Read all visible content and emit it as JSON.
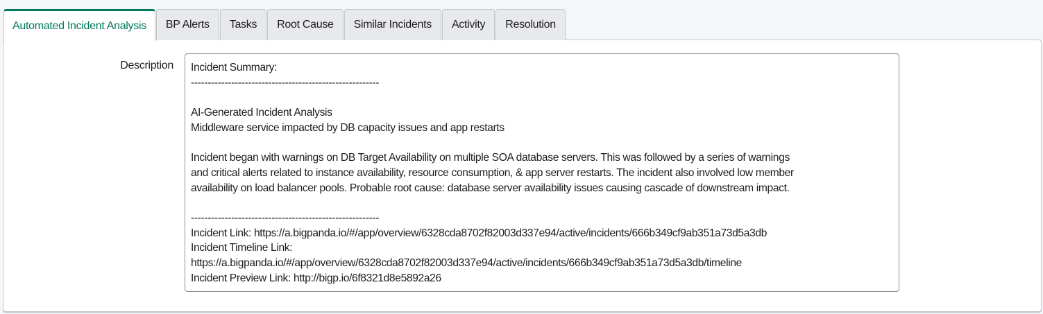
{
  "tabs": [
    {
      "label": "Automated Incident Analysis",
      "active": true
    },
    {
      "label": "BP Alerts"
    },
    {
      "label": "Tasks"
    },
    {
      "label": "Root Cause"
    },
    {
      "label": "Similar Incidents"
    },
    {
      "label": "Activity"
    },
    {
      "label": "Resolution"
    }
  ],
  "colors": {
    "accent": "#00795a",
    "tab_bg": "#e8e9ec"
  },
  "form": {
    "description_label": "Description",
    "description_value": "Incident Summary:\n--------------------------------------------------------\n\nAI-Generated Incident Analysis\nMiddleware service impacted by DB capacity issues and app restarts\n\nIncident began with warnings on DB Target Availability on multiple SOA database servers. This was followed by a series of warnings\nand critical alerts related to instance availability, resource consumption, & app server restarts. The incident also involved low member\navailability on load balancer pools. Probable root cause: database server availability issues causing cascade of downstream impact.\n\n--------------------------------------------------------\nIncident Link: https://a.bigpanda.io/#/app/overview/6328cda8702f82003d337e94/active/incidents/666b349cf9ab351a73d5a3db\nIncident Timeline Link:\nhttps://a.bigpanda.io/#/app/overview/6328cda8702f82003d337e94/active/incidents/666b349cf9ab351a73d5a3db/timeline\nIncident Preview Link: http://bigp.io/6f8321d8e5892a26"
  }
}
